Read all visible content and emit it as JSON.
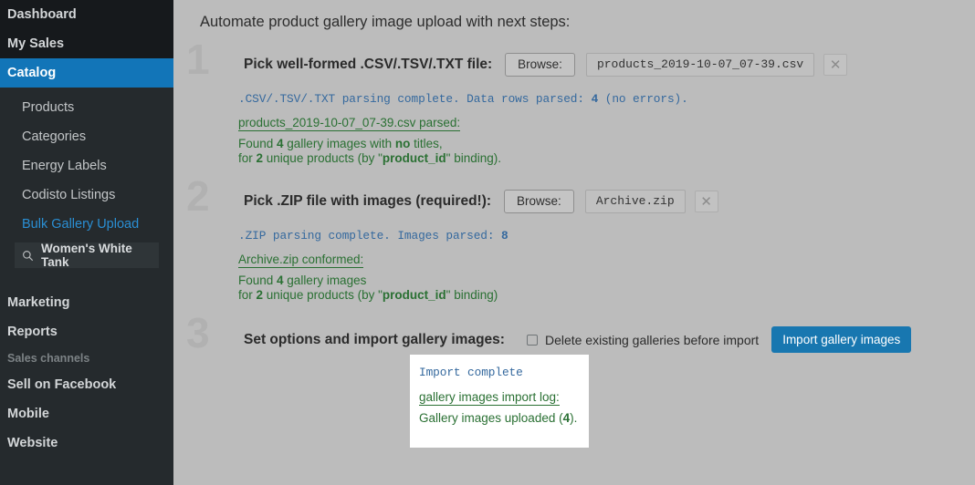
{
  "sidebar": {
    "top_items": [
      {
        "label": "Dashboard",
        "active": false
      },
      {
        "label": "My Sales",
        "active": false
      },
      {
        "label": "Catalog",
        "active": true
      }
    ],
    "sub_items": [
      {
        "label": "Products",
        "link": false
      },
      {
        "label": "Categories",
        "link": false
      },
      {
        "label": "Energy Labels",
        "link": false
      },
      {
        "label": "Codisto Listings",
        "link": false
      },
      {
        "label": "Bulk Gallery Upload",
        "link": true
      }
    ],
    "search": {
      "icon": "search-icon",
      "value": "Women's White Tank"
    },
    "bottom_items": [
      {
        "label": "Marketing"
      },
      {
        "label": "Reports"
      }
    ],
    "section_label": "Sales channels",
    "channel_items": [
      {
        "label": "Sell on Facebook"
      },
      {
        "label": "Mobile"
      },
      {
        "label": "Website"
      }
    ],
    "accent_color": "#1275b8"
  },
  "main": {
    "page_title": "Automate product gallery image upload with next steps:",
    "steps": [
      {
        "number": "1",
        "title": "Pick well-formed .CSV/.TSV/.TXT file:",
        "browse_label": "Browse:",
        "file_name": "products_2019-10-07_07-39.csv",
        "clear_icon": "close-icon",
        "status": ".CSV/.TSV/.TXT parsing complete. Data rows parsed: 4 (no errors).",
        "log_head": "products_2019-10-07_07-39.csv parsed:",
        "log_lines": [
          "Found 4 gallery images with no titles,",
          "for 2 unique products (by \"product_id\" binding)."
        ]
      },
      {
        "number": "2",
        "title": "Pick .ZIP file with images (required!):",
        "browse_label": "Browse:",
        "file_name": "Archive.zip",
        "clear_icon": "close-icon",
        "status": ".ZIP parsing complete. Images parsed: 8",
        "log_head": "Archive.zip conformed:",
        "log_lines": [
          "Found 4 gallery images",
          "for 2 unique products (by \"product_id\" binding)"
        ]
      },
      {
        "number": "3",
        "title": "Set options and import gallery images:",
        "checkbox_label": "Delete existing galleries before import",
        "checkbox_checked": false,
        "import_button": "Import gallery images"
      }
    ],
    "import_panel": {
      "status": "Import complete",
      "log_head": "gallery images import log:",
      "log_line": "Gallery images uploaded (4)."
    },
    "colors": {
      "background": "#bcbcbc",
      "status_blue": "#35699e",
      "log_green": "#2a7033",
      "primary_button": "#1877b0"
    }
  }
}
